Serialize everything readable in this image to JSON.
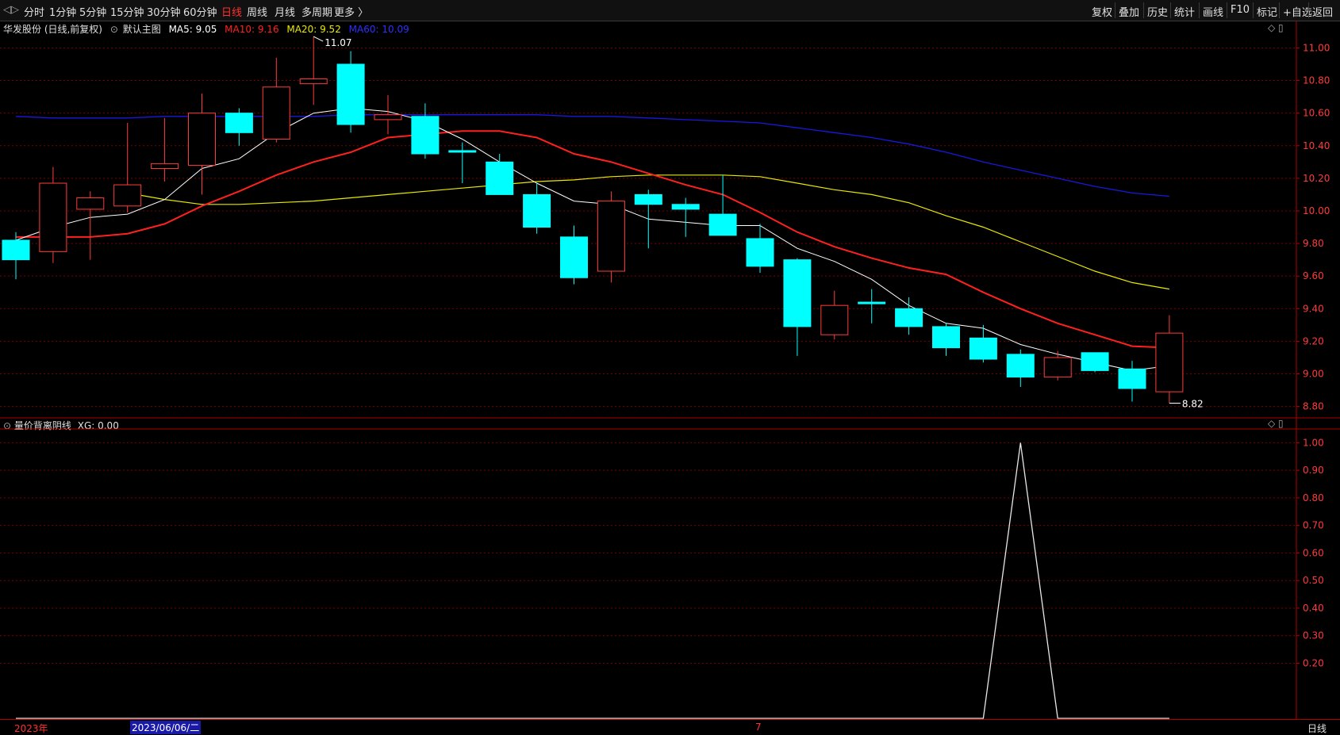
{
  "toolbar": {
    "left_items": [
      {
        "label": "分时",
        "active": false
      },
      {
        "label": "1分钟",
        "active": false
      },
      {
        "label": "5分钟",
        "active": false
      },
      {
        "label": "15分钟",
        "active": false
      },
      {
        "label": "30分钟",
        "active": false
      },
      {
        "label": "60分钟",
        "active": false
      },
      {
        "label": "日线",
        "active": true
      },
      {
        "label": "周线",
        "active": false
      },
      {
        "label": "月线",
        "active": false
      },
      {
        "label": "多周期",
        "active": false
      },
      {
        "label": "更多 〉",
        "active": false
      }
    ],
    "right_items": [
      "复权",
      "叠加",
      "历史",
      "统计",
      "画线",
      "F10",
      "标记",
      "+自选",
      "返回"
    ]
  },
  "main_panel": {
    "stock_title": "华发股份 (日线,前复权)",
    "template_label": "默认主图",
    "ma5": "MA5: 9.05",
    "ma10": "MA10: 9.16",
    "ma20": "MA20: 9.52",
    "ma60": "MA60: 10.09",
    "high_marker": "11.07",
    "low_marker": "8.82",
    "price_ticks": [
      "11.00",
      "10.80",
      "10.60",
      "10.40",
      "10.20",
      "10.00",
      "9.80",
      "9.60",
      "9.40",
      "9.20",
      "9.00",
      "8.80"
    ]
  },
  "indicator_panel": {
    "title": "量价背离阴线",
    "value": "XG: 0.00",
    "ticks": [
      "1.00",
      "0.90",
      "0.80",
      "0.70",
      "0.60",
      "0.50",
      "0.40",
      "0.30",
      "0.20"
    ]
  },
  "bottom": {
    "year_label": "2023年",
    "date_label": "2023/06/06/二",
    "month_label": "7",
    "period_label": "日线"
  },
  "colors": {
    "up": "#ff3b3b",
    "down": "#00ffff",
    "ma5": "#ffffff",
    "ma10": "#ff2020",
    "ma20": "#e8e800",
    "ma60": "#1818e0",
    "grid": "#7a0000"
  },
  "chart_data": [
    {
      "type": "candlestick",
      "title": "华发股份 (日线,前复权)",
      "ylim": [
        8.73,
        11.08
      ],
      "candles": [
        {
          "o": 9.82,
          "h": 9.87,
          "l": 9.58,
          "c": 9.7
        },
        {
          "o": 9.75,
          "h": 10.27,
          "l": 9.68,
          "c": 10.17
        },
        {
          "o": 10.01,
          "h": 10.12,
          "l": 9.7,
          "c": 10.08
        },
        {
          "o": 10.03,
          "h": 10.54,
          "l": 9.99,
          "c": 10.16
        },
        {
          "o": 10.26,
          "h": 10.57,
          "l": 10.18,
          "c": 10.29
        },
        {
          "o": 10.28,
          "h": 10.72,
          "l": 10.1,
          "c": 10.6
        },
        {
          "o": 10.6,
          "h": 10.63,
          "l": 10.4,
          "c": 10.48
        },
        {
          "o": 10.44,
          "h": 10.94,
          "l": 10.42,
          "c": 10.76
        },
        {
          "o": 10.78,
          "h": 11.07,
          "l": 10.65,
          "c": 10.81
        },
        {
          "o": 10.9,
          "h": 10.98,
          "l": 10.48,
          "c": 10.53
        },
        {
          "o": 10.56,
          "h": 10.71,
          "l": 10.47,
          "c": 10.59
        },
        {
          "o": 10.58,
          "h": 10.66,
          "l": 10.32,
          "c": 10.35
        },
        {
          "o": 10.37,
          "h": 10.42,
          "l": 10.17,
          "c": 10.36
        },
        {
          "o": 10.3,
          "h": 10.35,
          "l": 10.11,
          "c": 10.1
        },
        {
          "o": 10.1,
          "h": 10.17,
          "l": 9.86,
          "c": 9.9
        },
        {
          "o": 9.84,
          "h": 9.91,
          "l": 9.55,
          "c": 9.59
        },
        {
          "o": 9.63,
          "h": 10.12,
          "l": 9.56,
          "c": 10.06
        },
        {
          "o": 10.1,
          "h": 10.13,
          "l": 9.77,
          "c": 10.04
        },
        {
          "o": 10.04,
          "h": 10.08,
          "l": 9.84,
          "c": 10.01
        },
        {
          "o": 9.98,
          "h": 10.22,
          "l": 9.87,
          "c": 9.85
        },
        {
          "o": 9.83,
          "h": 9.92,
          "l": 9.62,
          "c": 9.66
        },
        {
          "o": 9.7,
          "h": 9.71,
          "l": 9.11,
          "c": 9.29
        },
        {
          "o": 9.24,
          "h": 9.51,
          "l": 9.21,
          "c": 9.42
        },
        {
          "o": 9.44,
          "h": 9.52,
          "l": 9.31,
          "c": 9.43
        },
        {
          "o": 9.4,
          "h": 9.47,
          "l": 9.24,
          "c": 9.29
        },
        {
          "o": 9.29,
          "h": 9.31,
          "l": 9.11,
          "c": 9.16
        },
        {
          "o": 9.22,
          "h": 9.3,
          "l": 9.07,
          "c": 9.09
        },
        {
          "o": 9.12,
          "h": 9.15,
          "l": 8.92,
          "c": 8.98
        },
        {
          "o": 8.98,
          "h": 9.14,
          "l": 8.96,
          "c": 9.1
        },
        {
          "o": 9.13,
          "h": 9.13,
          "l": 9.01,
          "c": 9.02
        },
        {
          "o": 9.03,
          "h": 9.08,
          "l": 8.83,
          "c": 8.91
        },
        {
          "o": 8.89,
          "h": 9.36,
          "l": 8.82,
          "c": 9.25
        }
      ],
      "ma5": [
        9.82,
        9.9,
        9.96,
        9.98,
        10.07,
        10.26,
        10.32,
        10.48,
        10.6,
        10.63,
        10.61,
        10.55,
        10.44,
        10.3,
        10.17,
        10.06,
        10.04,
        9.95,
        9.93,
        9.91,
        9.91,
        9.77,
        9.69,
        9.58,
        9.42,
        9.31,
        9.28,
        9.18,
        9.12,
        9.07,
        9.02,
        9.05
      ],
      "ma10": [
        9.84,
        9.84,
        9.84,
        9.86,
        9.92,
        10.03,
        10.12,
        10.22,
        10.3,
        10.36,
        10.45,
        10.47,
        10.49,
        10.49,
        10.45,
        10.35,
        10.3,
        10.23,
        10.16,
        10.1,
        9.99,
        9.87,
        9.78,
        9.71,
        9.65,
        9.61,
        9.5,
        9.4,
        9.31,
        9.24,
        9.17,
        9.16
      ],
      "ma20": [
        10.11,
        10.07,
        10.04,
        10.04,
        10.05,
        10.06,
        10.08,
        10.1,
        10.12,
        10.14,
        10.16,
        10.18,
        10.19,
        10.21,
        10.22,
        10.22,
        10.22,
        10.21,
        10.17,
        10.13,
        10.1,
        10.05,
        9.97,
        9.9,
        9.81,
        9.72,
        9.63,
        9.56,
        9.52
      ],
      "ma60": [
        10.58,
        10.57,
        10.57,
        10.57,
        10.58,
        10.58,
        10.58,
        10.58,
        10.58,
        10.59,
        10.59,
        10.59,
        10.59,
        10.59,
        10.59,
        10.58,
        10.58,
        10.57,
        10.56,
        10.55,
        10.54,
        10.51,
        10.48,
        10.45,
        10.41,
        10.36,
        10.3,
        10.25,
        10.2,
        10.15,
        10.11,
        10.09
      ]
    },
    {
      "type": "line",
      "title": "量价背离阴线",
      "ylim": [
        0,
        1.05
      ],
      "series": [
        {
          "name": "XG",
          "values": [
            0,
            0,
            0,
            0,
            0,
            0,
            0,
            0,
            0,
            0,
            0,
            0,
            0,
            0,
            0,
            0,
            0,
            0,
            0,
            0,
            0,
            0,
            0,
            0,
            0,
            0,
            0,
            1,
            0,
            0,
            0,
            0
          ]
        }
      ]
    }
  ]
}
